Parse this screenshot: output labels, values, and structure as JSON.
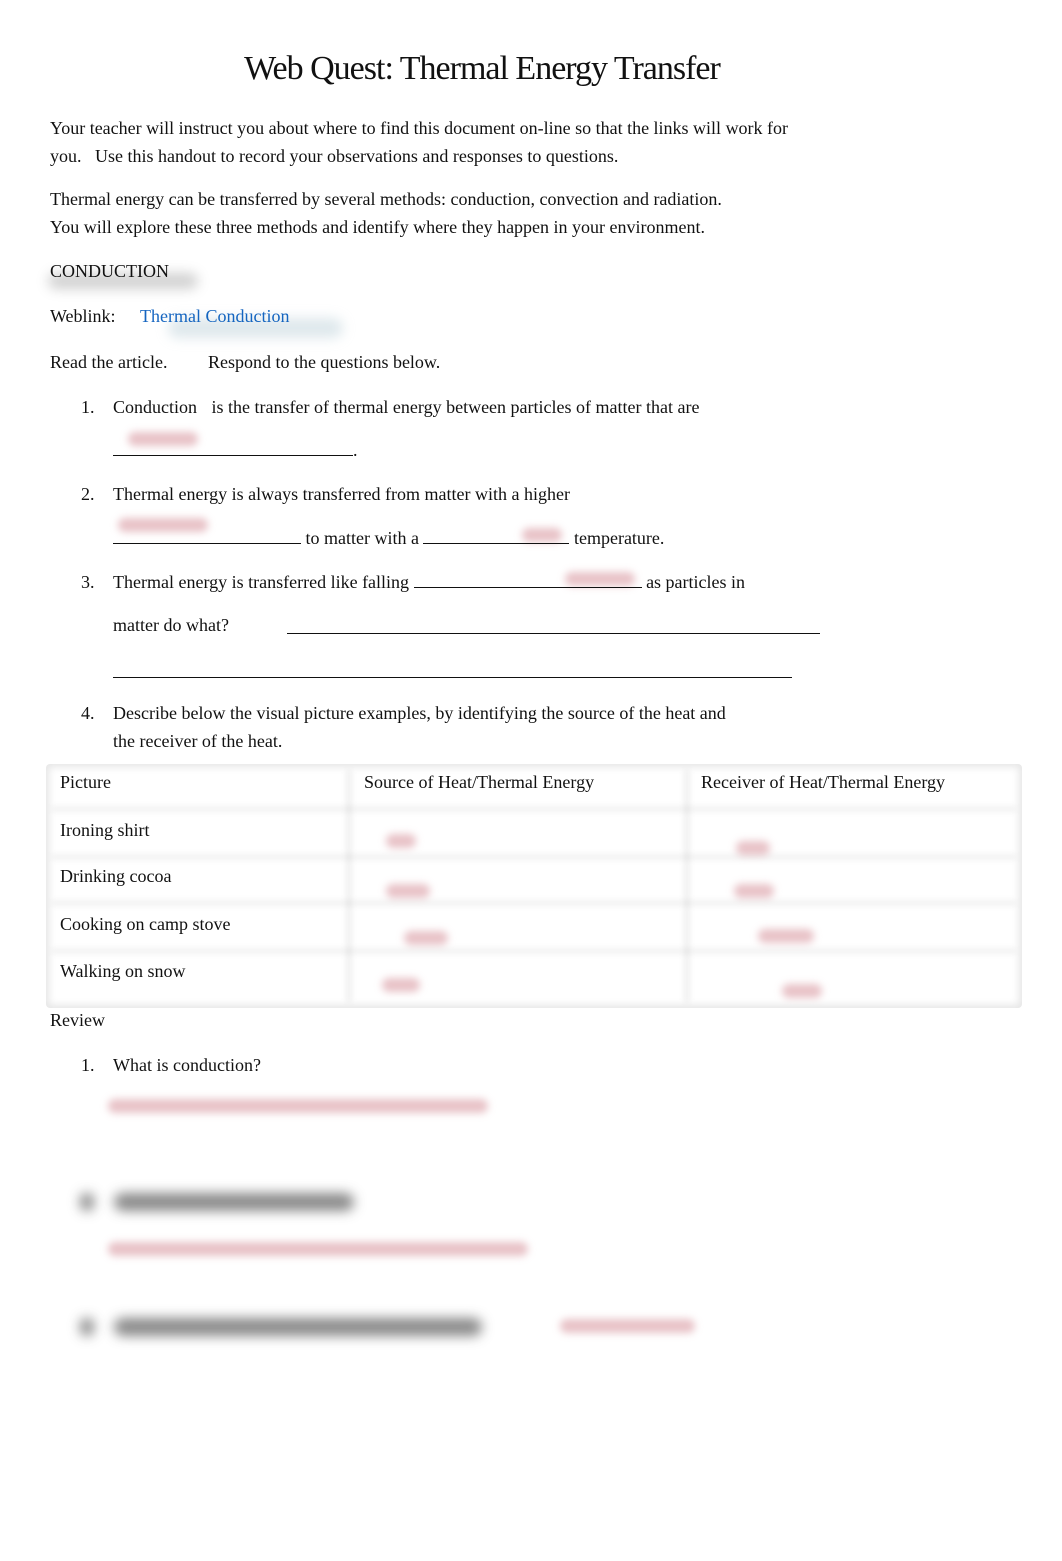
{
  "document": {
    "title": "Web Quest: Thermal Energy Transfer",
    "intro": [
      "Your teacher will instruct you about where to find this document on-line so that the links will work for",
      "you.   Use this handout to record your observations and responses to questions."
    ],
    "overview": [
      "Thermal energy can be transferred by several methods: conduction, convection and radiation.",
      "You will explore these three methods and identify where they happen in your environment."
    ]
  },
  "conduction": {
    "heading": "CONDUCTION",
    "weblink_label": "Weblink:",
    "weblink_text": "Thermal Conduction",
    "instructions_1": "Read the article.",
    "instructions_2": "Respond to the questions below.",
    "questions": [
      {
        "number": "1.",
        "lead": "Conduction",
        "text": "is the transfer of thermal energy between particles of matter that are",
        "end": ".",
        "answer": "[blurred]"
      },
      {
        "number": "2.",
        "text": "Thermal energy is always transferred from matter with a higher",
        "middle": "to matter with a",
        "end": "temperature.",
        "answers": [
          "[blurred]",
          "[blurred]"
        ]
      },
      {
        "number": "3.",
        "text": "Thermal energy is transferred like falling",
        "after_blank": "as particles in",
        "line2": "matter do what?",
        "answer": "[blurred]"
      },
      {
        "number": "4.",
        "text_line1": "Describe below the visual picture examples, by identifying the source of the heat and",
        "text_line2": "the receiver of the heat."
      }
    ],
    "table": {
      "headers": [
        "Picture",
        "Source of Heat/Thermal Energy",
        "Receiver of Heat/Thermal Energy"
      ],
      "rows": [
        {
          "picture": "Ironing shirt",
          "source": "[blurred]",
          "receiver": "[blurred]"
        },
        {
          "picture": "Drinking cocoa",
          "source": "[blurred]",
          "receiver": "[blurred]"
        },
        {
          "picture": "Cooking on camp stove",
          "source": "[blurred]",
          "receiver": "[blurred]"
        },
        {
          "picture": "Walking on snow",
          "source": "[blurred]",
          "receiver": "[blurred]"
        }
      ]
    }
  },
  "review": {
    "heading": "Review",
    "questions": [
      {
        "number": "1.",
        "text": "What is conduction?",
        "answer": "[blurred]"
      },
      {
        "number": "2.",
        "text": "[blurred]",
        "answer": "[blurred]"
      },
      {
        "number": "3.",
        "text": "[blurred]",
        "answer": "[blurred]"
      }
    ]
  },
  "colors": {
    "link": "#1565c0",
    "answer_blur": "#cd7882",
    "text": "#111111"
  }
}
